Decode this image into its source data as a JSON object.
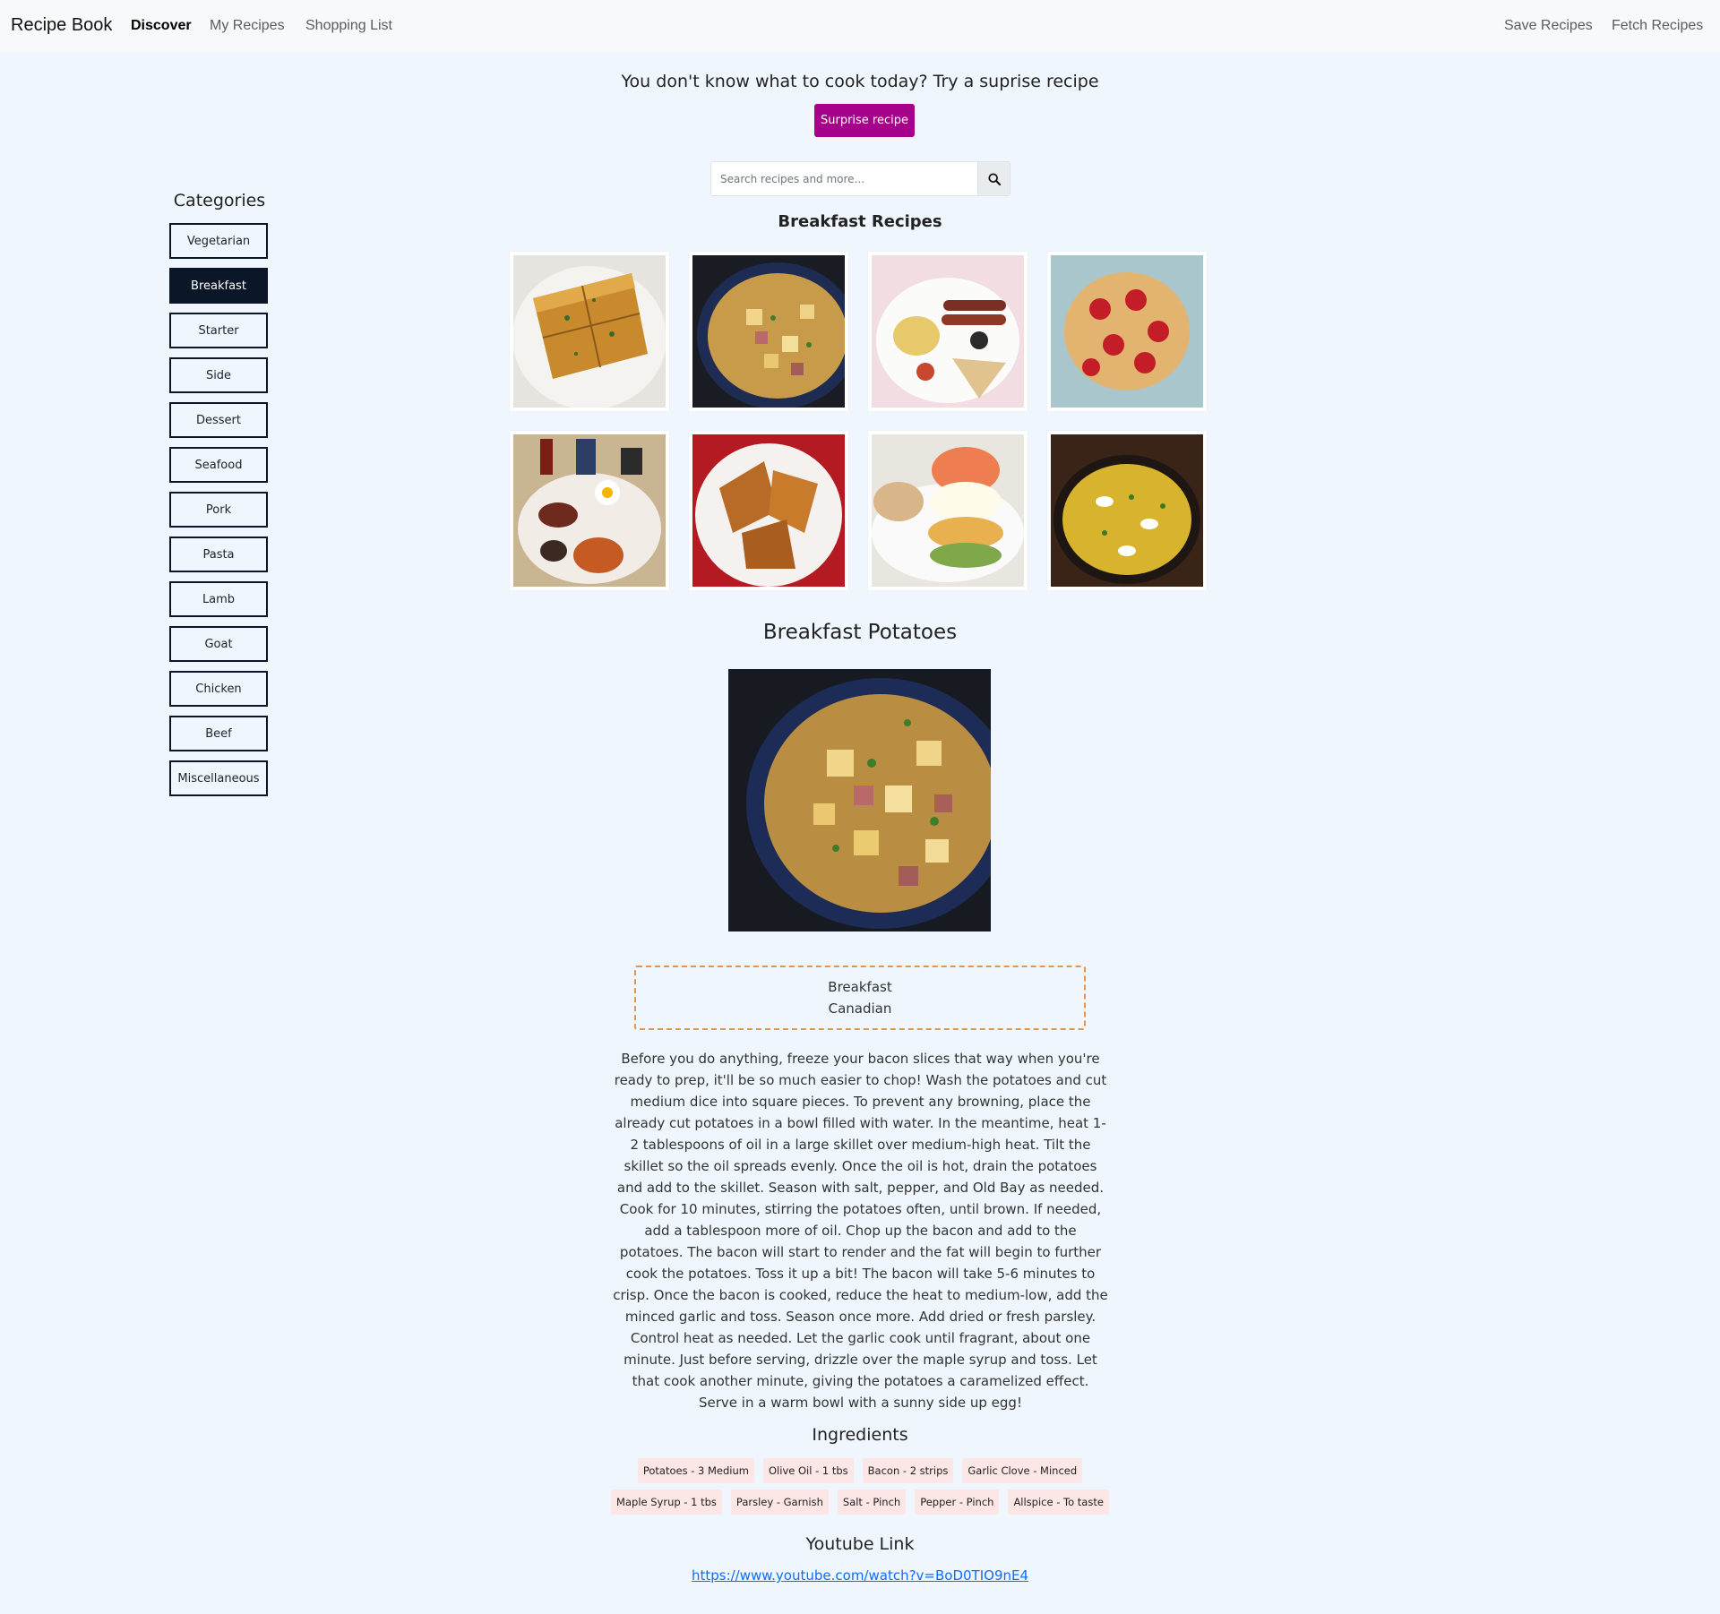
{
  "navbar": {
    "brand": "Recipe Book",
    "links": [
      "Discover",
      "My Recipes",
      "Shopping List"
    ],
    "right_links": [
      "Save Recipes",
      "Fetch Recipes"
    ]
  },
  "surprise": {
    "title": "You don't know what to cook today? Try a suprise recipe",
    "button": "Surprise recipe"
  },
  "search": {
    "placeholder": "Search recipes and more..."
  },
  "categories": {
    "title": "Categories",
    "items": [
      "Vegetarian",
      "Breakfast",
      "Starter",
      "Side",
      "Dessert",
      "Seafood",
      "Pork",
      "Pasta",
      "Lamb",
      "Goat",
      "Chicken",
      "Beef",
      "Miscellaneous"
    ],
    "active": "Breakfast"
  },
  "recipe_list": {
    "title": "Breakfast Recipes"
  },
  "recipe": {
    "title": "Breakfast Potatoes",
    "category": "Breakfast",
    "area": "Canadian",
    "instructions": "Before you do anything, freeze your bacon slices that way when you're ready to prep, it'll be so much easier to chop! Wash the potatoes and cut medium dice into square pieces. To prevent any browning, place the already cut potatoes in a bowl filled with water. In the meantime, heat 1-2 tablespoons of oil in a large skillet over medium-high heat. Tilt the skillet so the oil spreads evenly. Once the oil is hot, drain the potatoes and add to the skillet. Season with salt, pepper, and Old Bay as needed. Cook for 10 minutes, stirring the potatoes often, until brown. If needed, add a tablespoon more of oil. Chop up the bacon and add to the potatoes. The bacon will start to render and the fat will begin to further cook the potatoes. Toss it up a bit! The bacon will take 5-6 minutes to crisp. Once the bacon is cooked, reduce the heat to medium-low, add the minced garlic and toss. Season once more. Add dried or fresh parsley. Control heat as needed. Let the garlic cook until fragrant, about one minute. Just before serving, drizzle over the maple syrup and toss. Let that cook another minute, giving the potatoes a caramelized effect. Serve in a warm bowl with a sunny side up egg!",
    "ingredients_title": "Ingredients",
    "ingredients": [
      "Potatoes - 3 Medium",
      "Olive Oil - 1 tbs",
      "Bacon - 2 strips",
      "Garlic Clove - Minced",
      "Maple Syrup - 1 tbs",
      "Parsley - Garnish",
      "Salt - Pinch",
      "Pepper - Pinch",
      "Allspice - To taste"
    ],
    "youtube_title": "Youtube Link",
    "youtube_url": "https://www.youtube.com/watch?v=BoD0TIO9nE4"
  },
  "colors": {
    "accent": "#a5018a",
    "active_category": "#0b1628",
    "tags_border": "#e2954d",
    "ingredient_bg": "#fde6e6",
    "page_bg": "#eff6fe"
  }
}
